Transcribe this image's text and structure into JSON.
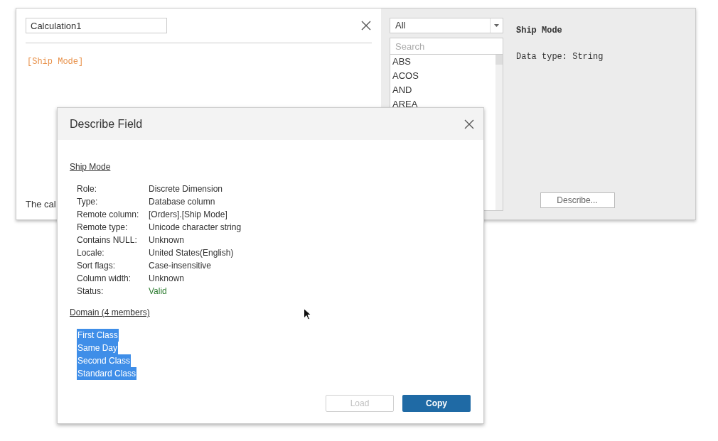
{
  "editor": {
    "name_value": "Calculation1",
    "formula": "[Ship Mode]",
    "status_text": "The cal"
  },
  "functions": {
    "filter": "All",
    "search_placeholder": "Search",
    "items": [
      "ABS",
      "ACOS",
      "AND",
      "AREA"
    ],
    "help_title": "Ship Mode",
    "help_text": "Data type: String",
    "describe_button": "Describe..."
  },
  "dialog": {
    "title": "Describe Field",
    "field_name": "Ship Mode",
    "properties": [
      {
        "label": "Role:",
        "value": "Discrete Dimension",
        "kind": "plain"
      },
      {
        "label": "Type:",
        "value": "Database column",
        "kind": "plain"
      },
      {
        "label": "Remote column:",
        "value": "[Orders].[Ship Mode]",
        "kind": "plain"
      },
      {
        "label": "Remote type:",
        "value": "Unicode character string",
        "kind": "plain"
      },
      {
        "label": "Contains NULL:",
        "value": "Unknown",
        "kind": "plain"
      },
      {
        "label": "Locale:",
        "value": "United States(English)",
        "kind": "plain"
      },
      {
        "label": "Sort flags:",
        "value": "Case-insensitive",
        "kind": "plain"
      },
      {
        "label": "Column width:",
        "value": "Unknown",
        "kind": "plain"
      },
      {
        "label": "Status:",
        "value": "Valid",
        "kind": "status"
      }
    ],
    "domain_title": "Domain (4 members)",
    "members": [
      {
        "label": "First Class",
        "selected": true
      },
      {
        "label": "Same Day",
        "selected": true
      },
      {
        "label": "Second Class",
        "selected": true
      },
      {
        "label": "Standard Class",
        "selected": true
      }
    ],
    "buttons": [
      {
        "label": "Load",
        "kind": "secondary",
        "disabled": true
      },
      {
        "label": "Copy",
        "kind": "primary",
        "disabled": false
      }
    ]
  }
}
